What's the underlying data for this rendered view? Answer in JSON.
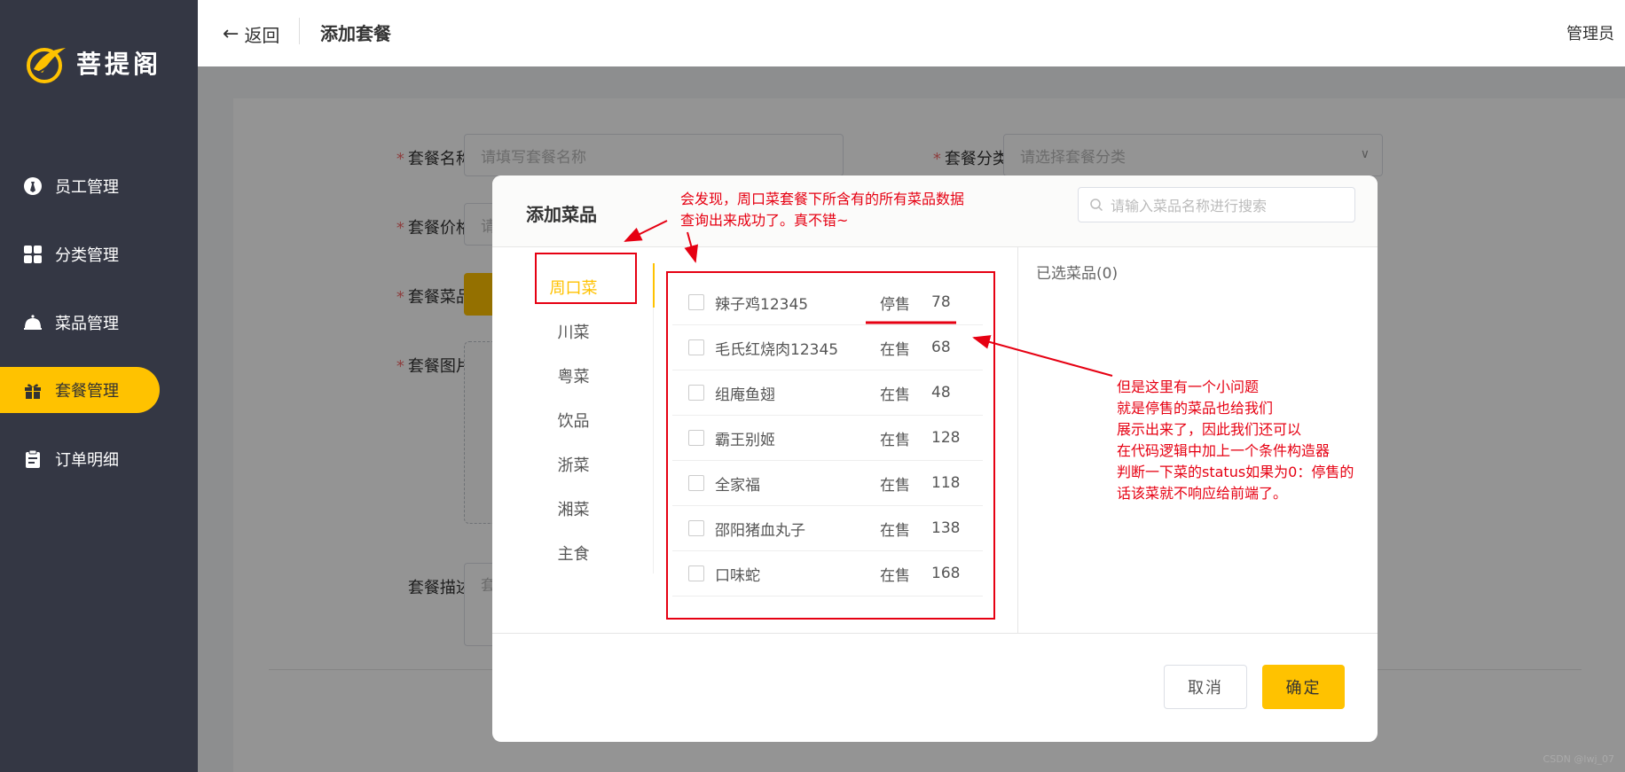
{
  "app": {
    "logo_text": "菩提阁"
  },
  "sidebar": {
    "items": [
      {
        "label": "员工管理",
        "icon": "employee-icon"
      },
      {
        "label": "分类管理",
        "icon": "category-icon"
      },
      {
        "label": "菜品管理",
        "icon": "dish-icon"
      },
      {
        "label": "套餐管理",
        "icon": "gift-icon",
        "active": true
      },
      {
        "label": "订单明细",
        "icon": "clipboard-icon"
      }
    ]
  },
  "header": {
    "back_label": "返回",
    "title": "添加套餐",
    "user": "管理员"
  },
  "form": {
    "name_label": "套餐名称:",
    "name_placeholder": "请填写套餐名称",
    "category_label": "套餐分类:",
    "category_placeholder": "请选择套餐分类",
    "price_label": "套餐价格:",
    "price_placeholder": "请",
    "dishes_label": "套餐菜品:",
    "image_label": "套餐图片:",
    "desc_label": "套餐描述:",
    "desc_placeholder": "套",
    "add_button_partial": "+"
  },
  "dialog": {
    "title": "添加菜品",
    "search_placeholder": "请输入菜品名称进行搜索",
    "categories": [
      "周口菜",
      "川菜",
      "粤菜",
      "饮品",
      "浙菜",
      "湘菜",
      "主食"
    ],
    "active_category": "周口菜",
    "dishes": [
      {
        "name": "辣子鸡12345",
        "status": "停售",
        "price": "78"
      },
      {
        "name": "毛氏红烧肉12345",
        "status": "在售",
        "price": "68"
      },
      {
        "name": "组庵鱼翅",
        "status": "在售",
        "price": "48"
      },
      {
        "name": "霸王别姬",
        "status": "在售",
        "price": "128"
      },
      {
        "name": "全家福",
        "status": "在售",
        "price": "118"
      },
      {
        "name": "邵阳猪血丸子",
        "status": "在售",
        "price": "138"
      },
      {
        "name": "口味蛇",
        "status": "在售",
        "price": "168"
      }
    ],
    "selected_label": "已选菜品(0)",
    "cancel_label": "取消",
    "ok_label": "确定"
  },
  "annotations": {
    "top_note_line1": "会发现，周口菜套餐下所含有的所有菜品数据",
    "top_note_line2": "查询出来成功了。真不错~",
    "right_note_lines": [
      "但是这里有一个小问题",
      "就是停售的菜品也给我们",
      "展示出来了，因此我们还可以",
      "在代码逻辑中加上一个条件构造器",
      "判断一下菜的status如果为0：停售的",
      "话该菜就不响应给前端了。"
    ],
    "color": "#e60012"
  },
  "watermark": "CSDN @lwj_07",
  "colors": {
    "accent": "#ffc200",
    "sidebar_bg": "#343744"
  }
}
